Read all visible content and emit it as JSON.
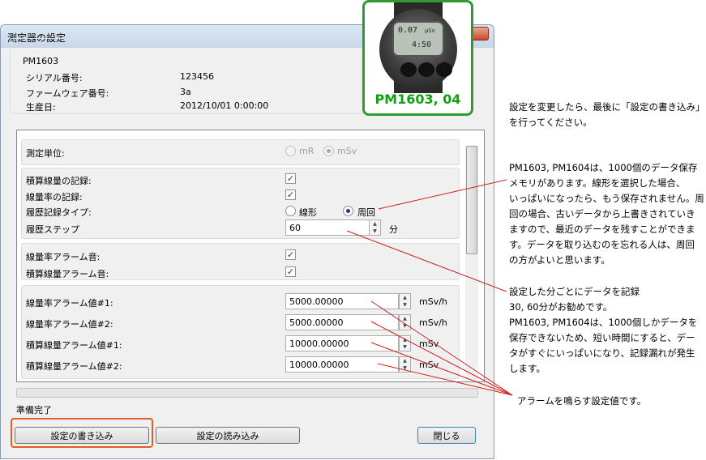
{
  "window": {
    "title": "測定器の設定"
  },
  "device_info": {
    "group_title": "PM1603",
    "serial_label": "シリアル番号:",
    "serial_value": "123456",
    "firmware_label": "ファームウェア番号:",
    "firmware_value": "3a",
    "production_label": "生産日:",
    "production_value": "2012/10/01 0:00:00"
  },
  "device_image": {
    "label": "PM1603, 04",
    "lcd_top": "0.07",
    "lcd_unit": "μSv",
    "lcd_bottom": "4:50"
  },
  "settings": {
    "unit_label": "測定単位:",
    "unit_options": [
      "mR",
      "mSv"
    ],
    "unit_selected": "mSv",
    "dose_record_label": "積算線量の記録:",
    "dose_record_checked": true,
    "rate_record_label": "線量率の記録:",
    "rate_record_checked": true,
    "history_type_label": "履歴記録タイプ:",
    "history_options": [
      "線形",
      "周回"
    ],
    "history_selected": "周回",
    "history_step_label": "履歴ステップ",
    "history_step_value": "60",
    "history_step_unit": "分",
    "rate_alarm_sound_label": "線量率アラーム音:",
    "rate_alarm_sound_checked": true,
    "dose_alarm_sound_label": "積算線量アラーム音:",
    "dose_alarm_sound_checked": true,
    "alarms": [
      {
        "label": "線量率アラーム値#1:",
        "value": "5000.00000",
        "unit": "mSv/h"
      },
      {
        "label": "線量率アラーム値#2:",
        "value": "5000.00000",
        "unit": "mSv/h"
      },
      {
        "label": "積算線量アラーム値#1:",
        "value": "10000.00000",
        "unit": "mSv"
      },
      {
        "label": "積算線量アラーム値#2:",
        "value": "10000.00000",
        "unit": "mSv"
      }
    ]
  },
  "status": {
    "text": "準備完了"
  },
  "buttons": {
    "write": "設定の書き込み",
    "read": "設定の読み込み",
    "close": "閉じる"
  },
  "annotations": {
    "note1": [
      "設定を変更したら、最後に「設定の書き込み」",
      "を行ってください。"
    ],
    "note2": [
      "PM1603, PM1604は、1000個のデータ保存",
      "メモリがあります。線形を選択した場合、",
      "いっぱいになったら、もう保存されません。周",
      "回の場合、古いデータから上書きされていき",
      "ますので、最近のデータを残すことができま",
      "す。データを取り込むのを忘れる人は、周回",
      "の方がよいと思います。"
    ],
    "note3": [
      "設定した分ごとにデータを記録",
      "30, 60分がお勧めです。",
      "PM1603, PM1604は、1000個しかデータを",
      "保存できないため、短い時間にすると、デー",
      "タがすぐにいっぱいになり、記録漏れが発生",
      "します。"
    ],
    "note4": [
      "アラームを鳴らす設定値です。"
    ]
  },
  "colors": {
    "highlight": "#e35d2a",
    "device_border": "#2f9a2f",
    "annotation_line": "#d42020"
  }
}
